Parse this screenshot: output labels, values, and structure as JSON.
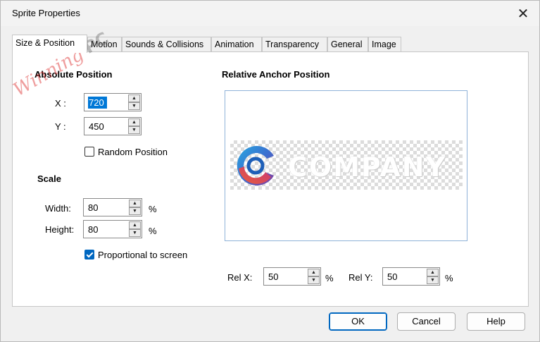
{
  "window": {
    "title": "Sprite Properties"
  },
  "tabs": [
    {
      "label": "Size & Position",
      "active": true
    },
    {
      "label": "Motion"
    },
    {
      "label": "Sounds & Collisions"
    },
    {
      "label": "Animation"
    },
    {
      "label": "Transparency"
    },
    {
      "label": "General"
    },
    {
      "label": "Image"
    }
  ],
  "absolute_position": {
    "title": "Absolute Position",
    "x_label": "X :",
    "x_value": "720",
    "y_label": "Y :",
    "y_value": "450",
    "random_label": "Random Position",
    "random_checked": false
  },
  "scale": {
    "title": "Scale",
    "width_label": "Width:",
    "width_value": "80",
    "height_label": "Height:",
    "height_value": "80",
    "unit": "%",
    "proportional_label": "Proportional to screen",
    "proportional_checked": true
  },
  "anchor": {
    "title": "Relative Anchor Position",
    "logo_text": "COMPANY",
    "relx_label": "Rel X:",
    "relx_value": "50",
    "rely_label": "Rel Y:",
    "rely_value": "50",
    "unit": "%"
  },
  "watermark": {
    "text": "Winning",
    "suffix": "PC"
  },
  "buttons": {
    "ok": "OK",
    "cancel": "Cancel",
    "help": "Help"
  },
  "colors": {
    "accent": "#0067c0",
    "selection": "#0078d7",
    "watermark": "#dc2828"
  }
}
